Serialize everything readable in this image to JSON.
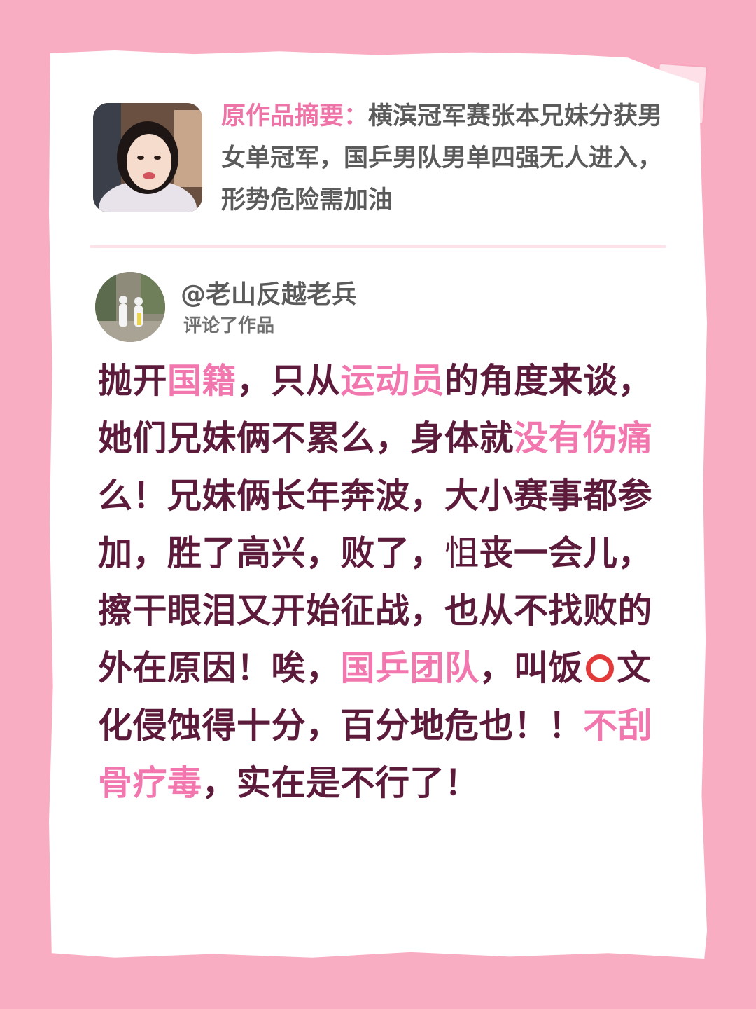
{
  "summary": {
    "label": "原作品摘要：",
    "text": "横滨冠军赛张本兄妹分获男女单冠军，国乒男队男单四强无人进入，形势危险需加油"
  },
  "commenter": {
    "name": "@老山反越老兵",
    "action": "评论了作品"
  },
  "comment": {
    "s1": "抛开",
    "h1": "国籍",
    "s2": "，只从",
    "h2": "运动员",
    "s3": "的角度来谈，她们兄妹俩不累么，身体就",
    "h3": "没有伤痛",
    "s4": "么！兄妹俩长年奔波，大小赛事都参加，胜了高兴，败了，",
    "s5": "怚",
    "s6": "丧一会儿，擦干眼泪又开始征战，也从不找败的外在原因！唉，",
    "h4": "国乒团队",
    "s7": "，叫饭",
    "s8": "文化侵蚀得十分，百分地危也！！",
    "h5": "不刮骨疗毒",
    "s9": "，实在是不行了！"
  },
  "colors": {
    "background": "#f9adc2",
    "card": "#ffffff",
    "accent_pink": "#f177ae",
    "body_text": "#5d1b3b",
    "summary_text": "#5b5b5b",
    "ring_red": "#e23a3a"
  },
  "icons": {
    "ring": "red-circle-emoji"
  }
}
